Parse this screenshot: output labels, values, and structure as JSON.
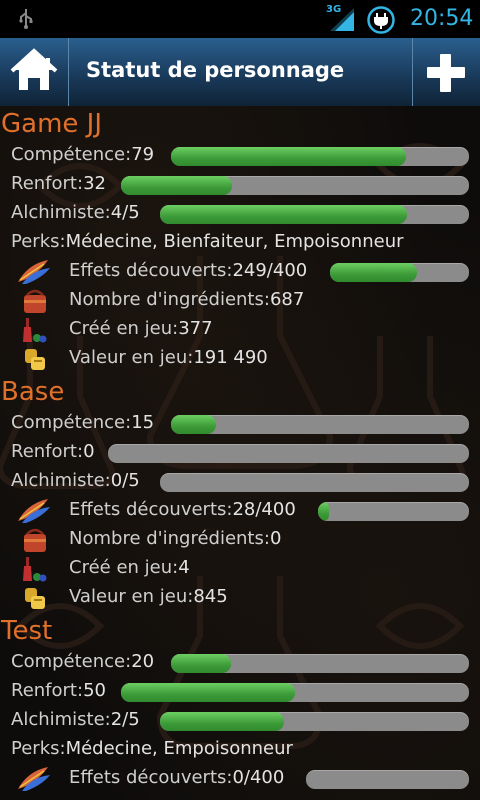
{
  "status_bar": {
    "network": "3G",
    "time": "20:54"
  },
  "action_bar": {
    "title": "Statut de personnage"
  },
  "characters": [
    {
      "name": "Game JJ",
      "competence": {
        "label": "Compétence:",
        "value": "79",
        "fill": 0.79
      },
      "renfort": {
        "label": "Renfort:",
        "value": "32",
        "fill": 0.32
      },
      "alchimiste": {
        "label": "Alchimiste:",
        "value": "4/5",
        "fill": 0.8
      },
      "perks": {
        "label": "Perks:",
        "value": "Médecine, Bienfaiteur, Empoisonneur"
      },
      "effets": {
        "label": "Effets découverts:",
        "value": "249/400",
        "fill": 0.6225
      },
      "ingredients": {
        "label": "Nombre d'ingrédients:",
        "value": "687"
      },
      "cree": {
        "label": "Créé en jeu:",
        "value": "377"
      },
      "valeur": {
        "label": "Valeur en jeu:",
        "value": "191 490"
      }
    },
    {
      "name": "Base",
      "competence": {
        "label": "Compétence:",
        "value": "15",
        "fill": 0.15
      },
      "renfort": {
        "label": "Renfort:",
        "value": "0",
        "fill": 0
      },
      "alchimiste": {
        "label": "Alchimiste:",
        "value": "0/5",
        "fill": 0
      },
      "effets": {
        "label": "Effets découverts:",
        "value": "28/400",
        "fill": 0.07
      },
      "ingredients": {
        "label": "Nombre d'ingrédients:",
        "value": "0"
      },
      "cree": {
        "label": "Créé en jeu:",
        "value": "4"
      },
      "valeur": {
        "label": "Valeur en jeu:",
        "value": "845"
      }
    },
    {
      "name": "Test",
      "competence": {
        "label": "Compétence:",
        "value": "20",
        "fill": 0.2
      },
      "renfort": {
        "label": "Renfort:",
        "value": "50",
        "fill": 0.5
      },
      "alchimiste": {
        "label": "Alchimiste:",
        "value": "2/5",
        "fill": 0.4
      },
      "perks": {
        "label": "Perks:",
        "value": "Médecine, Empoisonneur"
      },
      "effets": {
        "label": "Effets découverts:",
        "value": "0/400",
        "fill": 0
      }
    }
  ],
  "icons": {
    "effets": "feathers-icon",
    "ingredients": "satchel-icon",
    "cree": "potion-bottles-icon",
    "valeur": "gold-coins-icon"
  },
  "colors": {
    "accent": "#33b5e5",
    "section_title": "#e0702a",
    "bar_fill": "#4caf50",
    "bar_track": "#8b8b8b"
  }
}
